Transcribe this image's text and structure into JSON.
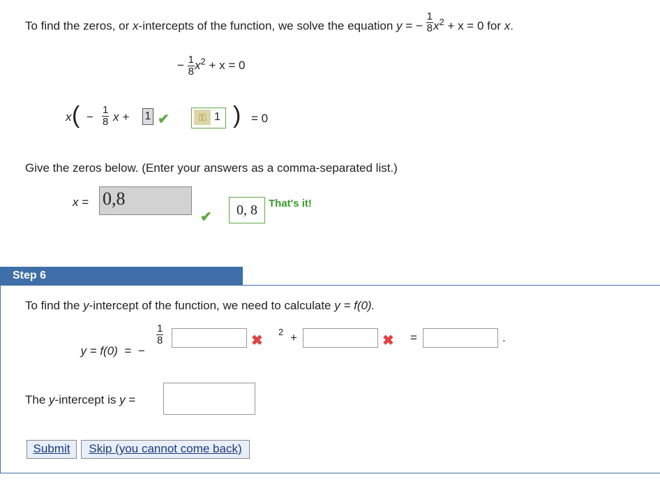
{
  "intro": {
    "text_before": "To find the zeros, or ",
    "var_x": "x",
    "text_mid": "-intercepts of the function, we solve the equation ",
    "var_y": "y",
    "eq_sign": "=",
    "minus": "−",
    "frac_num": "1",
    "frac_den": "8",
    "term_x2": "x",
    "exp": "2",
    "plus_x": "+ x = 0",
    "for_text": "for ",
    "for_var": "x",
    "period": "."
  },
  "eq1": {
    "minus": "−",
    "frac_num": "1",
    "frac_den": "8",
    "x": "x",
    "exp": "2",
    "rest": "+ x = 0"
  },
  "eq2": {
    "x": "x",
    "open_paren": "(",
    "minus": "−",
    "frac_num": "1",
    "frac_den": "8",
    "x2": "x +",
    "answer": "1",
    "key_answer": "1",
    "close_paren": ")",
    "rest": "= 0"
  },
  "zeros": {
    "prompt": "Give the zeros below. (Enter your answers as a comma-separated list.)",
    "label_x": "x",
    "label_eq": "=",
    "input_value": "0,8",
    "correct_value": "0, 8",
    "feedback": "That's it!"
  },
  "step": {
    "header": "Step 6",
    "text_before": "To find the ",
    "var_y": "y",
    "text_mid": "-intercept of the function, we need to calculate ",
    "eq": "y = f(0).",
    "formula_left": "y = f(0)  =  −",
    "frac_num": "1",
    "frac_den": "8",
    "exp": "2",
    "plus": "+",
    "equals": "=",
    "period": "."
  },
  "yint": {
    "text": "The ",
    "var_y": "y",
    "text_after": "-intercept is ",
    "var_y2": "y",
    "eq": "="
  },
  "buttons": {
    "submit": "Submit",
    "skip": "Skip (you cannot come back)"
  },
  "colors": {
    "step_header_bg": "#3f6fa8",
    "check": "#5fa845",
    "cross": "#e04343",
    "feedback": "#3a9a2a"
  }
}
